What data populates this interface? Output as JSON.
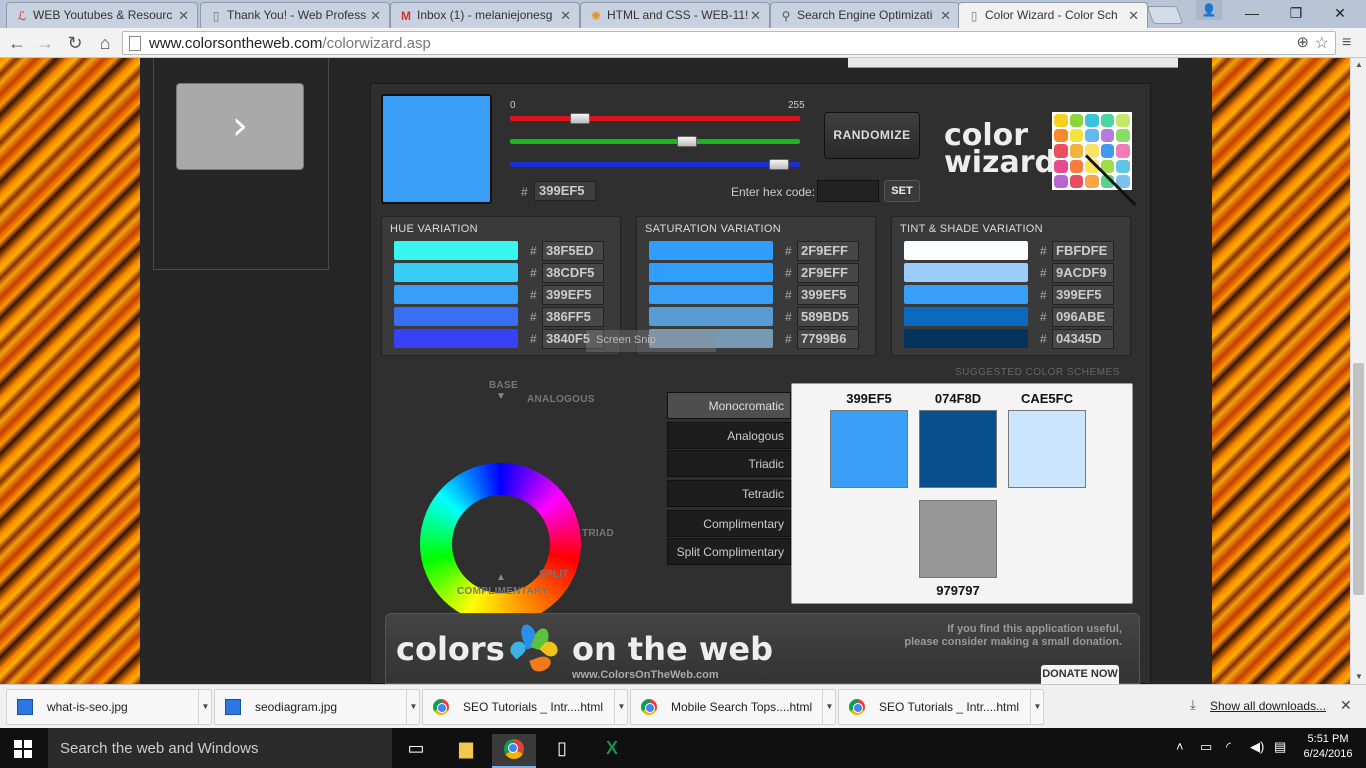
{
  "browser": {
    "tabs": [
      {
        "title": "WEB Youtubes & Resourc",
        "icon": "lynda-icon"
      },
      {
        "title": "Thank You! - Web Profess",
        "icon": "page-icon"
      },
      {
        "title": "Inbox (1) - melaniejonesg",
        "icon": "gmail-icon"
      },
      {
        "title": "HTML and CSS - WEB-11!",
        "icon": "asterisk-icon"
      },
      {
        "title": "Search Engine Optimizati",
        "icon": "search-icon"
      },
      {
        "title": "Color Wizard - Color Sch",
        "icon": "page-icon",
        "active": true
      }
    ],
    "url_domain": "www.colorsontheweb.com",
    "url_path": "/colorwizard.asp"
  },
  "wizard": {
    "base_hex": "399EF5",
    "slider_min": "0",
    "slider_max": "255",
    "rgb": {
      "r": 57,
      "g": 158,
      "b": 245
    },
    "hex_label": "Enter hex code:",
    "hex_entry": "",
    "set_label": "SET",
    "randomize_label": "RANDOMIZE",
    "logo_line1": "color",
    "logo_line2": "wizard",
    "hash": "#"
  },
  "variations": {
    "hue": {
      "title": "HUE VARIATION",
      "rows": [
        "38F5ED",
        "38CDF5",
        "399EF5",
        "386FF5",
        "3840F5"
      ]
    },
    "saturation": {
      "title": "SATURATION VARIATION",
      "rows": [
        "2F9EFF",
        "2F9EFF",
        "399EF5",
        "589BD5",
        "7799B6"
      ]
    },
    "tint": {
      "title": "TINT & SHADE VARIATION",
      "rows": [
        "FBFDFE",
        "9ACDF9",
        "399EF5",
        "096ABE",
        "04345D"
      ]
    }
  },
  "screen_snip_label": "Screen Snip",
  "wheel_labels": {
    "base": "BASE",
    "analogous": "ANALOGOUS",
    "triad": "TRIAD",
    "split": "SPLIT",
    "complimentary": "COMPLIMENTARY"
  },
  "schemes": {
    "buttons": [
      "Monocromatic",
      "Analogous",
      "Triadic",
      "Tetradic",
      "Complimentary",
      "Split Complimentary"
    ],
    "selected": "Monocromatic",
    "suggested_label": "SUGGESTED COLOR SCHEMES",
    "colors": [
      "399EF5",
      "074F8D",
      "CAE5FC",
      "979797"
    ]
  },
  "banner": {
    "left_text": "colors",
    "right_text": "on the web",
    "url": "www.ColorsOnTheWeb.com",
    "donate_line1": "If you find this application useful,",
    "donate_line2": "please consider making a small donation.",
    "donate_button": "DONATE NOW"
  },
  "downloads": {
    "items": [
      {
        "name": "what-is-seo.jpg",
        "icon": "image-icon"
      },
      {
        "name": "seodiagram.jpg",
        "icon": "image-icon"
      },
      {
        "name": "SEO Tutorials _ Intr....html",
        "icon": "chrome-icon"
      },
      {
        "name": "Mobile Search Tops....html",
        "icon": "chrome-icon"
      },
      {
        "name": "SEO Tutorials _ Intr....html",
        "icon": "chrome-icon"
      }
    ],
    "show_all": "Show all downloads..."
  },
  "taskbar": {
    "search_placeholder": "Search the web and Windows",
    "time": "5:51 PM",
    "date": "6/24/2016"
  }
}
